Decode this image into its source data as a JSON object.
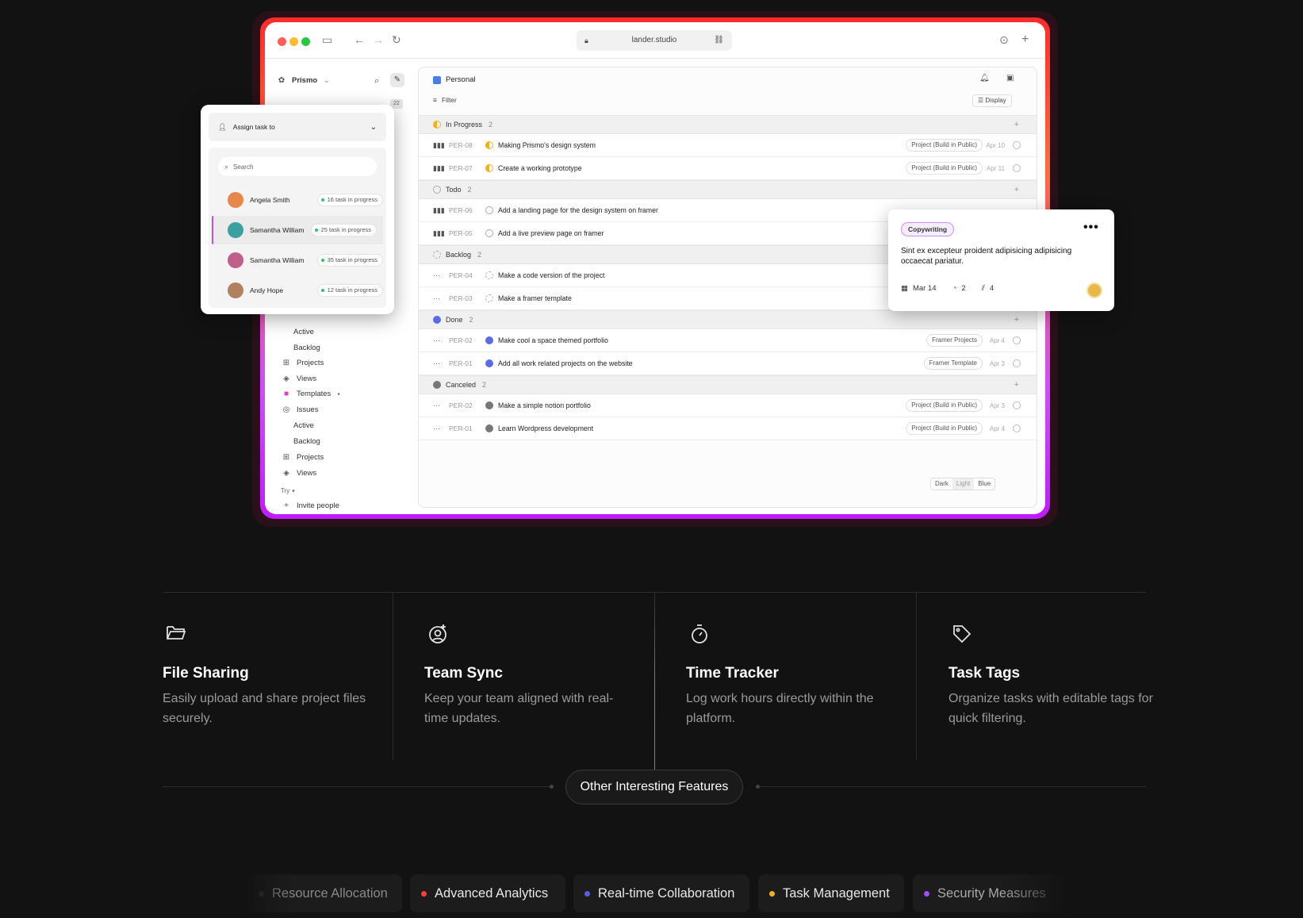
{
  "browser": {
    "url": "lander.studio"
  },
  "sidebar": {
    "workspace": "Prismo",
    "count": "22",
    "items": [
      {
        "label": "Active",
        "icon": "none"
      },
      {
        "label": "Backlog",
        "icon": "none"
      },
      {
        "label": "Projects",
        "icon": "grid-icon"
      },
      {
        "label": "Views",
        "icon": "layers-icon"
      },
      {
        "label": "Templates",
        "icon": "template-icon"
      },
      {
        "label": "Issues",
        "icon": "issues-icon"
      },
      {
        "label": "Active",
        "icon": "none"
      },
      {
        "label": "Backlog",
        "icon": "none"
      },
      {
        "label": "Projects",
        "icon": "grid-icon"
      },
      {
        "label": "Views",
        "icon": "layers-icon"
      }
    ],
    "try_label": "Try",
    "invite_label": "Invite people"
  },
  "main": {
    "title": "Personal",
    "filter_label": "Filter",
    "display_label": "Display",
    "groups": [
      {
        "name": "In Progress",
        "count": "2",
        "color": "#f2b01e"
      },
      {
        "name": "Todo",
        "count": "2",
        "color": "#bbbbbb"
      },
      {
        "name": "Backlog",
        "count": "2",
        "color": "#cccccc"
      },
      {
        "name": "Done",
        "count": "2",
        "color": "#5b6be8"
      },
      {
        "name": "Canceled",
        "count": "2",
        "color": "#777777"
      }
    ],
    "rows": [
      {
        "id": "PER-08",
        "title": "Making Prismo's design system",
        "tag": "Project (Build in Public)",
        "date": "Apr 10"
      },
      {
        "id": "PER-07",
        "title": "Create a working prototype",
        "tag": "Project (Build in Public)",
        "date": "Apr 11"
      },
      {
        "id": "PER-06",
        "title": "Add a landing page for the design system on framer",
        "tag": "",
        "date": ""
      },
      {
        "id": "PER-05",
        "title": "Add a live preview page on framer",
        "tag": "",
        "date": ""
      },
      {
        "id": "PER-04",
        "title": "Make a code version of the project",
        "tag": "",
        "date": ""
      },
      {
        "id": "PER-03",
        "title": "Make a framer template",
        "tag": "",
        "date": ""
      },
      {
        "id": "PER-02",
        "title": "Make cool a space themed portfolio",
        "tag": "Framer Projects",
        "date": "Apr 4"
      },
      {
        "id": "PER-01",
        "title": "Add all work related projects on the website",
        "tag": "Framer Template",
        "date": "Apr 3"
      },
      {
        "id": "PER-02",
        "title": "Make a simple notion portfolio",
        "tag": "Project (Build in Public)",
        "date": "Apr 3"
      },
      {
        "id": "PER-01",
        "title": "Learn Wordpress development",
        "tag": "Project (Build in Public)",
        "date": "Apr 4"
      }
    ],
    "themes": [
      "Dark",
      "Light",
      "Blue"
    ]
  },
  "assign": {
    "title": "Assign task to",
    "search_placeholder": "Search",
    "people": [
      {
        "name": "Angela Smith",
        "badge": "16 task in progress",
        "color": "#e8874a"
      },
      {
        "name": "Samantha William",
        "badge": "25 task in progress",
        "color": "#3aa0a0"
      },
      {
        "name": "Samantha William",
        "badge": "35 task in progress",
        "color": "#c0608a"
      },
      {
        "name": "Andy Hope",
        "badge": "12 task in progress",
        "color": "#b08060"
      }
    ]
  },
  "card": {
    "tag": "Copywriting",
    "text": "Sint ex excepteur proident adipisicing adipisicing occaecat pariatur.",
    "date": "Mar 14",
    "comments": "2",
    "attachments": "4"
  },
  "features": [
    {
      "icon": "folder-icon",
      "title": "File Sharing",
      "desc": "Easily upload and share project files securely."
    },
    {
      "icon": "user-sync-icon",
      "title": "Team Sync",
      "desc": "Keep your team aligned with real-time updates."
    },
    {
      "icon": "stopwatch-icon",
      "title": "Time Tracker",
      "desc": "Log work hours directly within the platform."
    },
    {
      "icon": "tag-icon",
      "title": "Task Tags",
      "desc": "Organize tasks with editable tags for quick filtering."
    }
  ],
  "other_features_label": "Other Interesting Features",
  "chips": [
    {
      "label": "Resource Allocation",
      "color": "#3a3a3a"
    },
    {
      "label": "Advanced Analytics",
      "color": "#ff3b3b"
    },
    {
      "label": "Real-time Collaboration",
      "color": "#5a5ae8"
    },
    {
      "label": "Task Management",
      "color": "#f2b01e"
    },
    {
      "label": "Security Measures",
      "color": "#a64aff"
    }
  ]
}
